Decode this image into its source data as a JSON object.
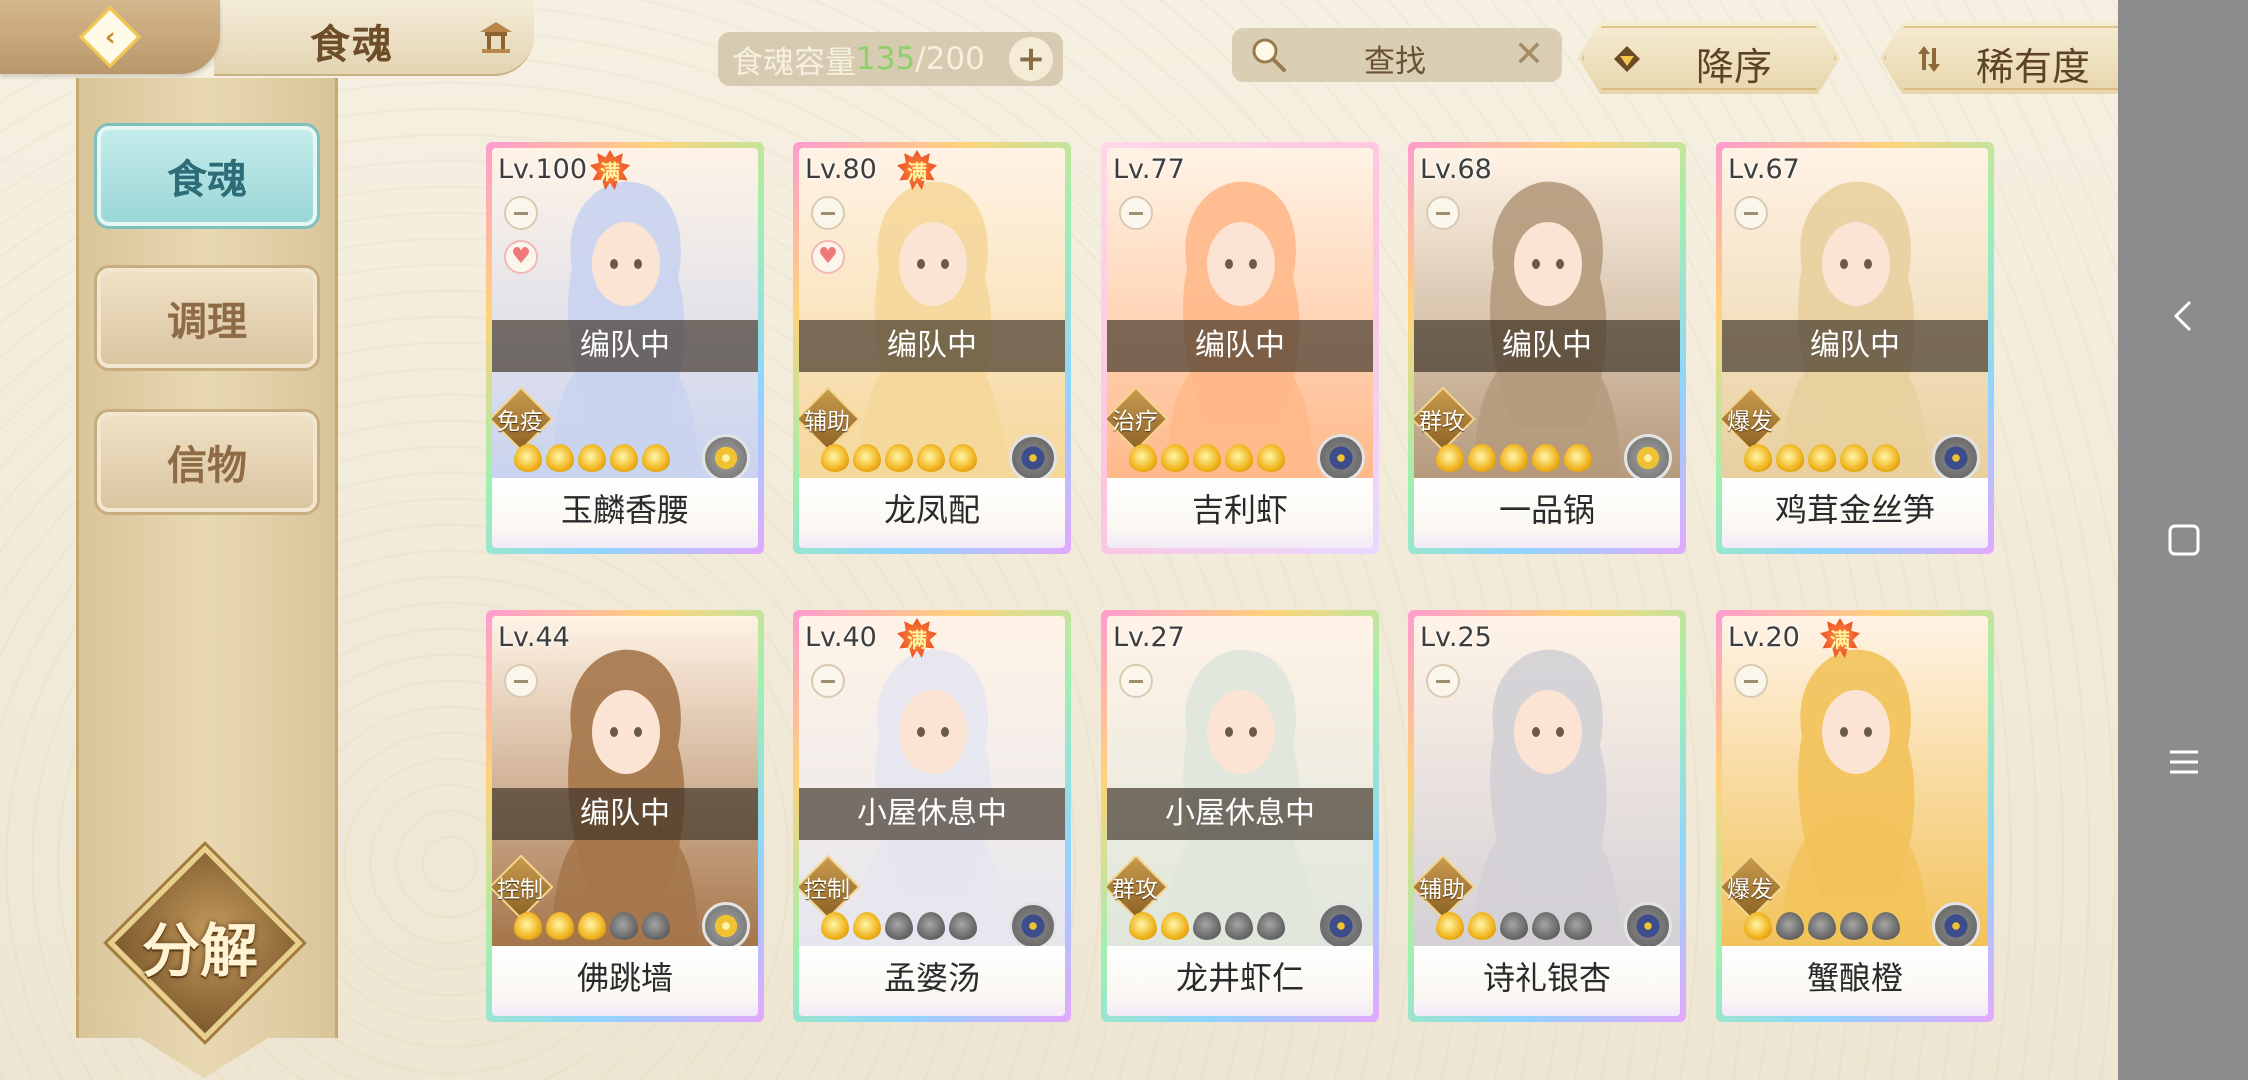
{
  "header": {
    "title": "食魂",
    "capacity_label": "食魂容量",
    "capacity_current": "135",
    "capacity_max": "/200",
    "capacity_add": "+",
    "search_placeholder": "查找",
    "search_clear": "✕",
    "sort_order_label": "降序",
    "sort_key_label": "稀有度"
  },
  "sidebar": {
    "tabs": [
      {
        "label": "食魂",
        "active": true
      },
      {
        "label": "调理",
        "active": false
      },
      {
        "label": "信物",
        "active": false
      }
    ],
    "decompose_label": "分解"
  },
  "cards": [
    {
      "level": "Lv.100",
      "maxed": true,
      "badge": "满",
      "heart": true,
      "status": "编队中",
      "role": "免疫",
      "stars": 5,
      "element": "gold",
      "name": "玉麟香腰",
      "hue": "#c9d3ef"
    },
    {
      "level": "Lv.80",
      "maxed": true,
      "badge": "满",
      "heart": true,
      "status": "编队中",
      "role": "辅助",
      "stars": 5,
      "element": "blue",
      "name": "龙凤配",
      "hue": "#f5d79a"
    },
    {
      "level": "Lv.77",
      "maxed": false,
      "badge": "",
      "heart": false,
      "status": "编队中",
      "role": "治疗",
      "stars": 5,
      "element": "blue",
      "name": "吉利虾",
      "hue": "#ffb88a"
    },
    {
      "level": "Lv.68",
      "maxed": false,
      "badge": "",
      "heart": false,
      "status": "编队中",
      "role": "群攻",
      "stars": 5,
      "element": "gold",
      "name": "一品锅",
      "hue": "#b59a7c"
    },
    {
      "level": "Lv.67",
      "maxed": false,
      "badge": "",
      "heart": false,
      "status": "编队中",
      "role": "爆发",
      "stars": 5,
      "element": "blue",
      "name": "鸡茸金丝笋",
      "hue": "#e8cf9e"
    },
    {
      "level": "Lv.44",
      "maxed": false,
      "badge": "",
      "heart": false,
      "status": "编队中",
      "role": "控制",
      "stars": 3,
      "element": "gold",
      "name": "佛跳墙",
      "hue": "#a5754a"
    },
    {
      "level": "Lv.40",
      "maxed": true,
      "badge": "满",
      "heart": false,
      "status": "小屋休息中",
      "role": "控制",
      "stars": 2,
      "element": "blue",
      "name": "孟婆汤",
      "hue": "#e6e6ef"
    },
    {
      "level": "Lv.27",
      "maxed": false,
      "badge": "",
      "heart": false,
      "status": "小屋休息中",
      "role": "群攻",
      "stars": 2,
      "element": "blue",
      "name": "龙井虾仁",
      "hue": "#dfe6dc"
    },
    {
      "level": "Lv.25",
      "maxed": false,
      "badge": "",
      "heart": false,
      "status": "",
      "role": "辅助",
      "stars": 2,
      "element": "blue",
      "name": "诗礼银杏",
      "hue": "#d3d0d6"
    },
    {
      "level": "Lv.20",
      "maxed": true,
      "badge": "满",
      "heart": false,
      "status": "",
      "role": "爆发",
      "stars": 1,
      "element": "blue",
      "name": "蟹酿橙",
      "hue": "#f2c25a"
    }
  ],
  "colors": {
    "accent_gold": "#c68a2a",
    "capacity_current": "#8ed06a",
    "active_tab": "#9bd7d6"
  }
}
